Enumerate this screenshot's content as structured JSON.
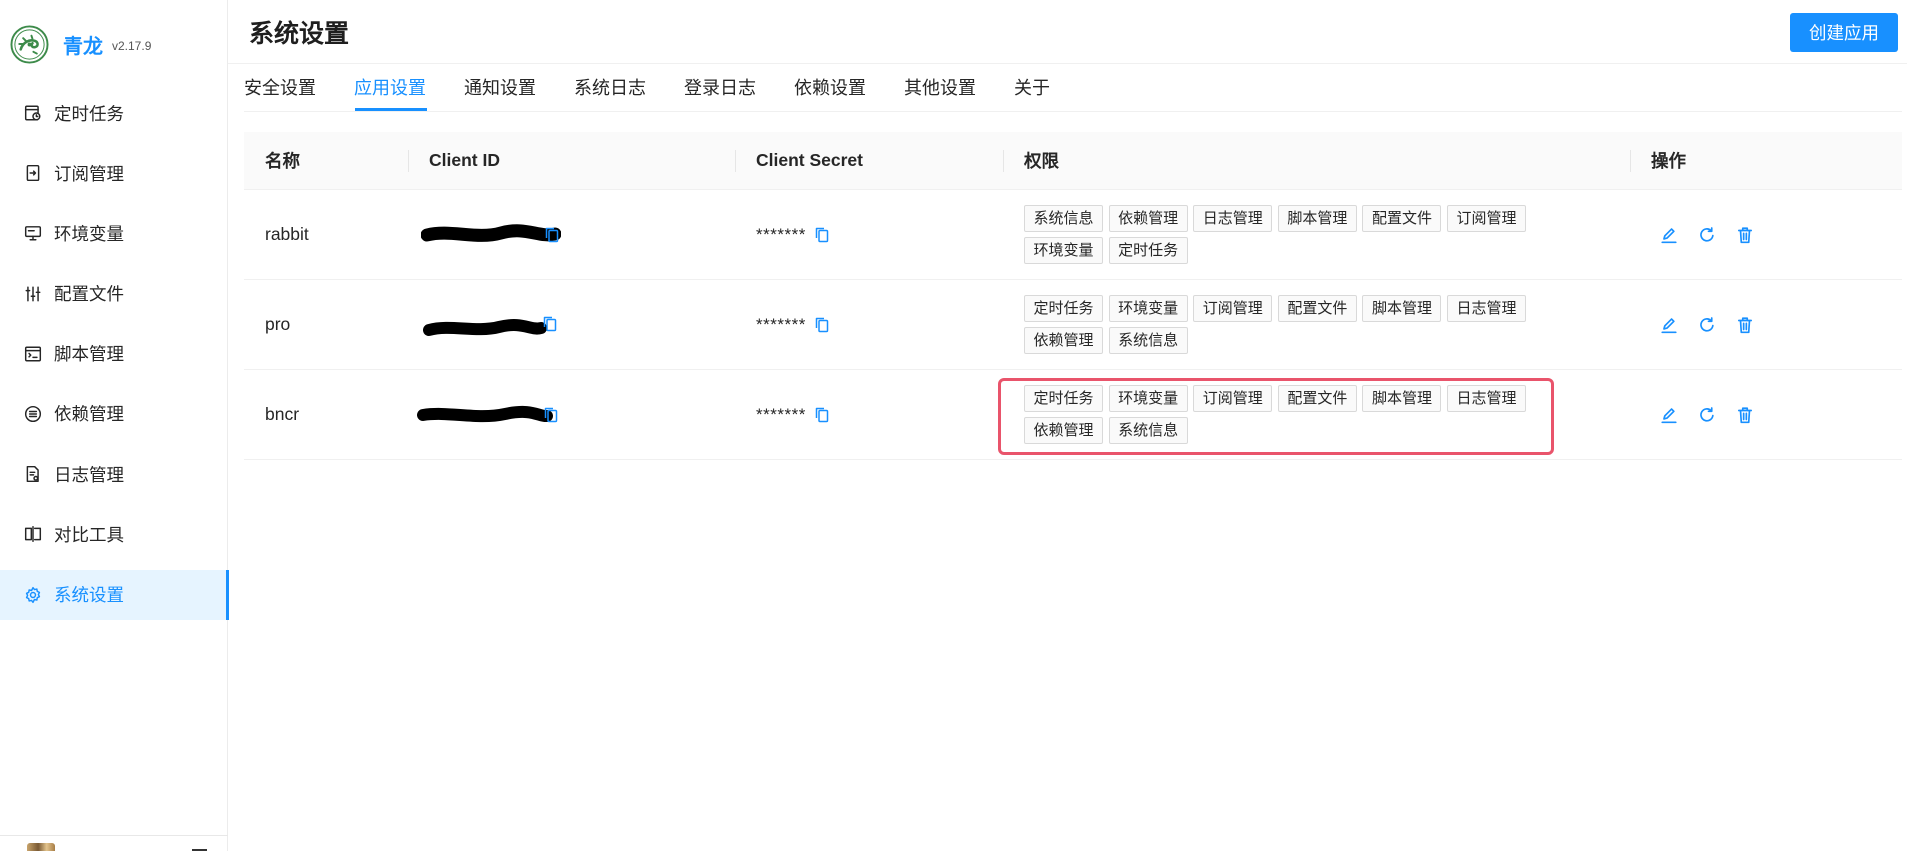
{
  "app": {
    "name": "青龙",
    "version": "v2.17.9"
  },
  "sidebar": {
    "items": [
      {
        "label": "定时任务",
        "icon": "schedule-icon"
      },
      {
        "label": "订阅管理",
        "icon": "subscription-icon"
      },
      {
        "label": "环境变量",
        "icon": "monitor-icon"
      },
      {
        "label": "配置文件",
        "icon": "sliders-icon"
      },
      {
        "label": "脚本管理",
        "icon": "code-file-icon"
      },
      {
        "label": "依赖管理",
        "icon": "dependency-icon"
      },
      {
        "label": "日志管理",
        "icon": "log-file-icon"
      },
      {
        "label": "对比工具",
        "icon": "diff-icon"
      },
      {
        "label": "系统设置",
        "icon": "gear-icon",
        "active": true
      }
    ]
  },
  "header": {
    "title": "系统设置",
    "create_button": "创建应用"
  },
  "tabs": [
    {
      "label": "安全设置"
    },
    {
      "label": "应用设置",
      "active": true
    },
    {
      "label": "通知设置"
    },
    {
      "label": "系统日志"
    },
    {
      "label": "登录日志"
    },
    {
      "label": "依赖设置"
    },
    {
      "label": "其他设置"
    },
    {
      "label": "关于"
    }
  ],
  "table": {
    "columns": {
      "name": "名称",
      "client_id": "Client ID",
      "client_secret": "Client Secret",
      "permissions": "权限",
      "actions": "操作"
    },
    "rows": [
      {
        "name": "rabbit",
        "client_id_redacted": true,
        "client_secret": "*******",
        "permissions": [
          "系统信息",
          "依赖管理",
          "日志管理",
          "脚本管理",
          "配置文件",
          "订阅管理",
          "环境变量",
          "定时任务"
        ],
        "actions": [
          "edit-icon",
          "reload-icon",
          "delete-icon"
        ]
      },
      {
        "name": "pro",
        "client_id_redacted": true,
        "client_secret": "*******",
        "permissions": [
          "定时任务",
          "环境变量",
          "订阅管理",
          "配置文件",
          "脚本管理",
          "日志管理",
          "依赖管理",
          "系统信息"
        ],
        "actions": [
          "edit-icon",
          "reload-icon",
          "delete-icon"
        ]
      },
      {
        "name": "bncr",
        "client_id_redacted": true,
        "client_secret": "*******",
        "permissions": [
          "定时任务",
          "环境变量",
          "订阅管理",
          "配置文件",
          "脚本管理",
          "日志管理",
          "依赖管理",
          "系统信息"
        ],
        "actions": [
          "edit-icon",
          "reload-icon",
          "delete-icon"
        ],
        "highlighted": true
      }
    ]
  },
  "colors": {
    "accent": "#1890ff",
    "highlight_box": "#e9546b",
    "logo_green": "#3d8b4a",
    "active_nav_bg": "#e6f4ff"
  }
}
